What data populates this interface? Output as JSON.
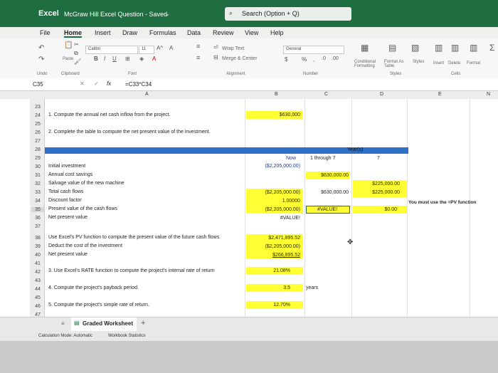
{
  "titlebar": {
    "app": "Excel",
    "doc": "McGraw Hill Excel Question - Saved",
    "search": "Search (Option + Q)"
  },
  "menu": [
    "File",
    "Home",
    "Insert",
    "Draw",
    "Formulas",
    "Data",
    "Review",
    "View",
    "Help"
  ],
  "ribbon": {
    "font_name": "Calibri",
    "font_size": "11",
    "grow": "A^",
    "shrink": "A",
    "wrap_text": "Wrap Text",
    "merge_center": "Merge & Center",
    "number_format": "General",
    "currency": "$",
    "percent": "%",
    "cond_format": "Conditional Formatting",
    "format_table": "Format As Table",
    "cell_styles": "Styles",
    "insert": "Insert",
    "delete": "Delete",
    "format": "Format",
    "groups": {
      "undo": "Undo",
      "clipboard": "Clipboard",
      "font": "Font",
      "alignment": "Alignment",
      "number": "Number",
      "styles": "Styles",
      "cells": "Cells"
    }
  },
  "formula_bar": {
    "name_box": "C35",
    "fx": "fx",
    "formula": "=C33*C34"
  },
  "columns": [
    "A",
    "B",
    "C",
    "D",
    "E",
    "N"
  ],
  "rows": {
    "n23": "23",
    "n24": "24",
    "n25": "25",
    "n26": "26",
    "n27": "27",
    "n28": "28",
    "n29": "29",
    "n30": "30",
    "n31": "31",
    "n32": "32",
    "n33": "33",
    "n34": "34",
    "n35": "35",
    "n36": "36",
    "n37": "37",
    "n38": "38",
    "n39": "39",
    "n40": "40",
    "n41": "41",
    "n42": "42",
    "n43": "43",
    "n44": "44",
    "n45": "45",
    "n46": "46",
    "n47": "47"
  },
  "cells": {
    "q1": "1. Compute the annual net cash inflow from the project.",
    "b24": "$630,000",
    "q2": "2. Complete the table to compute the net present value of the investment.",
    "years_hdr": "Year(s)",
    "now": "Now",
    "now_val": "($2,205,000.00)",
    "through": "1 through 7",
    "seven": "7",
    "a30": "Initial investment",
    "a31": "Annual cost savings",
    "c31": "$630,000.00",
    "a32": "Salvage value of the new machine",
    "d32": "$225,000.00",
    "a33": "Total cash flows",
    "b33": "($2,205,000.00)",
    "c33": "$630,000.00",
    "d33": "$225,000.00",
    "a34": "Discount factor",
    "b34": "1.00000",
    "a35": "Present value of the cash flows",
    "b35": "($2,205,000.00)",
    "c35": "#VALUE!",
    "d35": "$0.00",
    "a36": "Net present value",
    "b36": "#VALUE!",
    "note": "You must use the =PV function",
    "a38": "Use Excel's PV function to compute the present value of the future cash flows",
    "b38": "$2,471,895.52",
    "a39": "Deduct the cost of the investment",
    "b39": "($2,205,000.00)",
    "a40": "Net present value",
    "b40": "$266,895.52",
    "q3": "3. Use Excel's RATE function to compute the project's internal rate of return",
    "b42": "21.08%",
    "q4": "4. Compute the project's payback period.",
    "b44": "3.5",
    "c44": "years",
    "q5": "5. Compute the project's simple rate of return.",
    "b46": "12.70%"
  },
  "sheet_tab": "Graded Worksheet",
  "add_sheet": "+",
  "status": {
    "calc": "Calculation Mode: Automatic",
    "stats": "Workbook Statistics"
  },
  "colors": {
    "excel_green": "#1e6e42",
    "header_blue": "#2f6fc6",
    "yellow": "#ffff33"
  }
}
